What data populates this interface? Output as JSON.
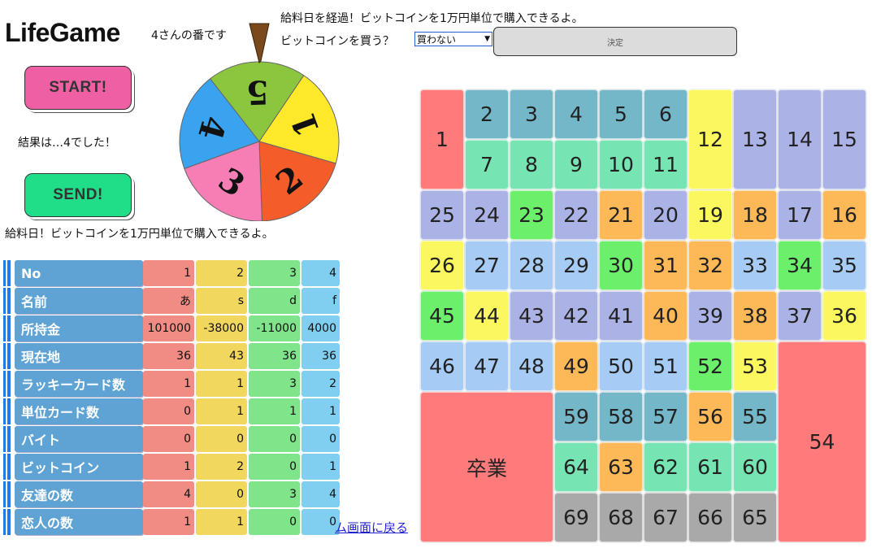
{
  "app_title": "LifeGame",
  "turn_text": "4さんの番です",
  "start_label": "START!",
  "send_label": "SEND!",
  "result_text": "結果は…4でした！",
  "payday_text": "給料日！ビットコインを1万円単位で購入できるよ。",
  "message_top": "給料日を経過！ビットコインを1万円単位で購入できるよ。",
  "buy_prompt": "ビットコインを買う？",
  "buy_select_value": "買わない",
  "decide_label": "決定",
  "back_link": "ム画面に戻る",
  "roulette": {
    "pointer_color": "#7a4a1c",
    "segments": [
      {
        "number": "4",
        "color": "#3aa3f0"
      },
      {
        "number": "5",
        "color": "#8cc63f"
      },
      {
        "number": "1",
        "color": "#ffe92a"
      },
      {
        "number": "2",
        "color": "#f45d2a"
      },
      {
        "number": "3",
        "color": "#f77db5"
      }
    ]
  },
  "players_table": {
    "columns": [
      {
        "color": "#f08c83"
      },
      {
        "color": "#f2d75f"
      },
      {
        "color": "#7fe48a"
      },
      {
        "color": "#80cff0"
      }
    ],
    "rows": [
      {
        "label": "No",
        "values": [
          "1",
          "2",
          "3",
          "4"
        ]
      },
      {
        "label": "名前",
        "values": [
          "あ",
          "s",
          "d",
          "f"
        ]
      },
      {
        "label": "所持金",
        "values": [
          "101000",
          "-38000",
          "-11000",
          "4000"
        ]
      },
      {
        "label": "現在地",
        "values": [
          "36",
          "43",
          "36",
          "36"
        ]
      },
      {
        "label": "ラッキーカード数",
        "values": [
          "1",
          "1",
          "3",
          "2"
        ]
      },
      {
        "label": "単位カード数",
        "values": [
          "0",
          "1",
          "1",
          "1"
        ]
      },
      {
        "label": "バイト",
        "values": [
          "0",
          "0",
          "0",
          "0"
        ]
      },
      {
        "label": "ビットコイン",
        "values": [
          "1",
          "2",
          "0",
          "1"
        ]
      },
      {
        "label": "友達の数",
        "values": [
          "4",
          "0",
          "3",
          "4"
        ]
      },
      {
        "label": "恋人の数",
        "values": [
          "1",
          "1",
          "0",
          "0"
        ]
      }
    ]
  },
  "board": {
    "color_key": {
      "red": "#ff7b7b",
      "teal": "#74b7c9",
      "mint": "#77e5b3",
      "yellow": "#fbf75f",
      "lavender": "#abb3e6",
      "green": "#6cf06c",
      "orange": "#fdb957",
      "lightblue": "#a6ccf5",
      "gray": "#a9a9a9"
    },
    "cells": [
      {
        "label": "1",
        "color": "red"
      },
      {
        "label": "2",
        "color": "teal"
      },
      {
        "label": "3",
        "color": "teal"
      },
      {
        "label": "4",
        "color": "teal"
      },
      {
        "label": "5",
        "color": "teal"
      },
      {
        "label": "6",
        "color": "teal"
      },
      {
        "label": "7",
        "color": "mint"
      },
      {
        "label": "8",
        "color": "mint"
      },
      {
        "label": "9",
        "color": "mint"
      },
      {
        "label": "10",
        "color": "mint"
      },
      {
        "label": "11",
        "color": "mint"
      },
      {
        "label": "12",
        "color": "yellow"
      },
      {
        "label": "13",
        "color": "lavender"
      },
      {
        "label": "14",
        "color": "lavender"
      },
      {
        "label": "15",
        "color": "lavender"
      },
      {
        "label": "25",
        "color": "lavender"
      },
      {
        "label": "24",
        "color": "lavender"
      },
      {
        "label": "23",
        "color": "green"
      },
      {
        "label": "22",
        "color": "lavender"
      },
      {
        "label": "21",
        "color": "orange"
      },
      {
        "label": "20",
        "color": "lavender"
      },
      {
        "label": "19",
        "color": "yellow"
      },
      {
        "label": "18",
        "color": "orange"
      },
      {
        "label": "17",
        "color": "lavender"
      },
      {
        "label": "16",
        "color": "orange"
      },
      {
        "label": "26",
        "color": "yellow"
      },
      {
        "label": "27",
        "color": "lightblue"
      },
      {
        "label": "28",
        "color": "lightblue"
      },
      {
        "label": "29",
        "color": "lightblue"
      },
      {
        "label": "30",
        "color": "green"
      },
      {
        "label": "31",
        "color": "orange"
      },
      {
        "label": "32",
        "color": "orange"
      },
      {
        "label": "33",
        "color": "lightblue"
      },
      {
        "label": "34",
        "color": "green"
      },
      {
        "label": "35",
        "color": "lightblue"
      },
      {
        "label": "45",
        "color": "green"
      },
      {
        "label": "44",
        "color": "yellow"
      },
      {
        "label": "43",
        "color": "lavender"
      },
      {
        "label": "42",
        "color": "lavender"
      },
      {
        "label": "41",
        "color": "lavender"
      },
      {
        "label": "40",
        "color": "orange"
      },
      {
        "label": "39",
        "color": "lavender"
      },
      {
        "label": "38",
        "color": "orange"
      },
      {
        "label": "37",
        "color": "lavender"
      },
      {
        "label": "36",
        "color": "yellow"
      },
      {
        "label": "46",
        "color": "lightblue"
      },
      {
        "label": "47",
        "color": "lightblue"
      },
      {
        "label": "48",
        "color": "lightblue"
      },
      {
        "label": "49",
        "color": "orange"
      },
      {
        "label": "50",
        "color": "lightblue"
      },
      {
        "label": "51",
        "color": "lightblue"
      },
      {
        "label": "52",
        "color": "green"
      },
      {
        "label": "53",
        "color": "yellow"
      },
      {
        "label": "54",
        "color": "red"
      },
      {
        "label": "卒業",
        "color": "red"
      },
      {
        "label": "59",
        "color": "teal"
      },
      {
        "label": "58",
        "color": "teal"
      },
      {
        "label": "57",
        "color": "teal"
      },
      {
        "label": "56",
        "color": "orange"
      },
      {
        "label": "55",
        "color": "teal"
      },
      {
        "label": "64",
        "color": "mint"
      },
      {
        "label": "63",
        "color": "orange"
      },
      {
        "label": "62",
        "color": "mint"
      },
      {
        "label": "61",
        "color": "mint"
      },
      {
        "label": "60",
        "color": "mint"
      },
      {
        "label": "69",
        "color": "gray"
      },
      {
        "label": "68",
        "color": "gray"
      },
      {
        "label": "67",
        "color": "gray"
      },
      {
        "label": "66",
        "color": "gray"
      },
      {
        "label": "65",
        "color": "gray"
      }
    ]
  }
}
